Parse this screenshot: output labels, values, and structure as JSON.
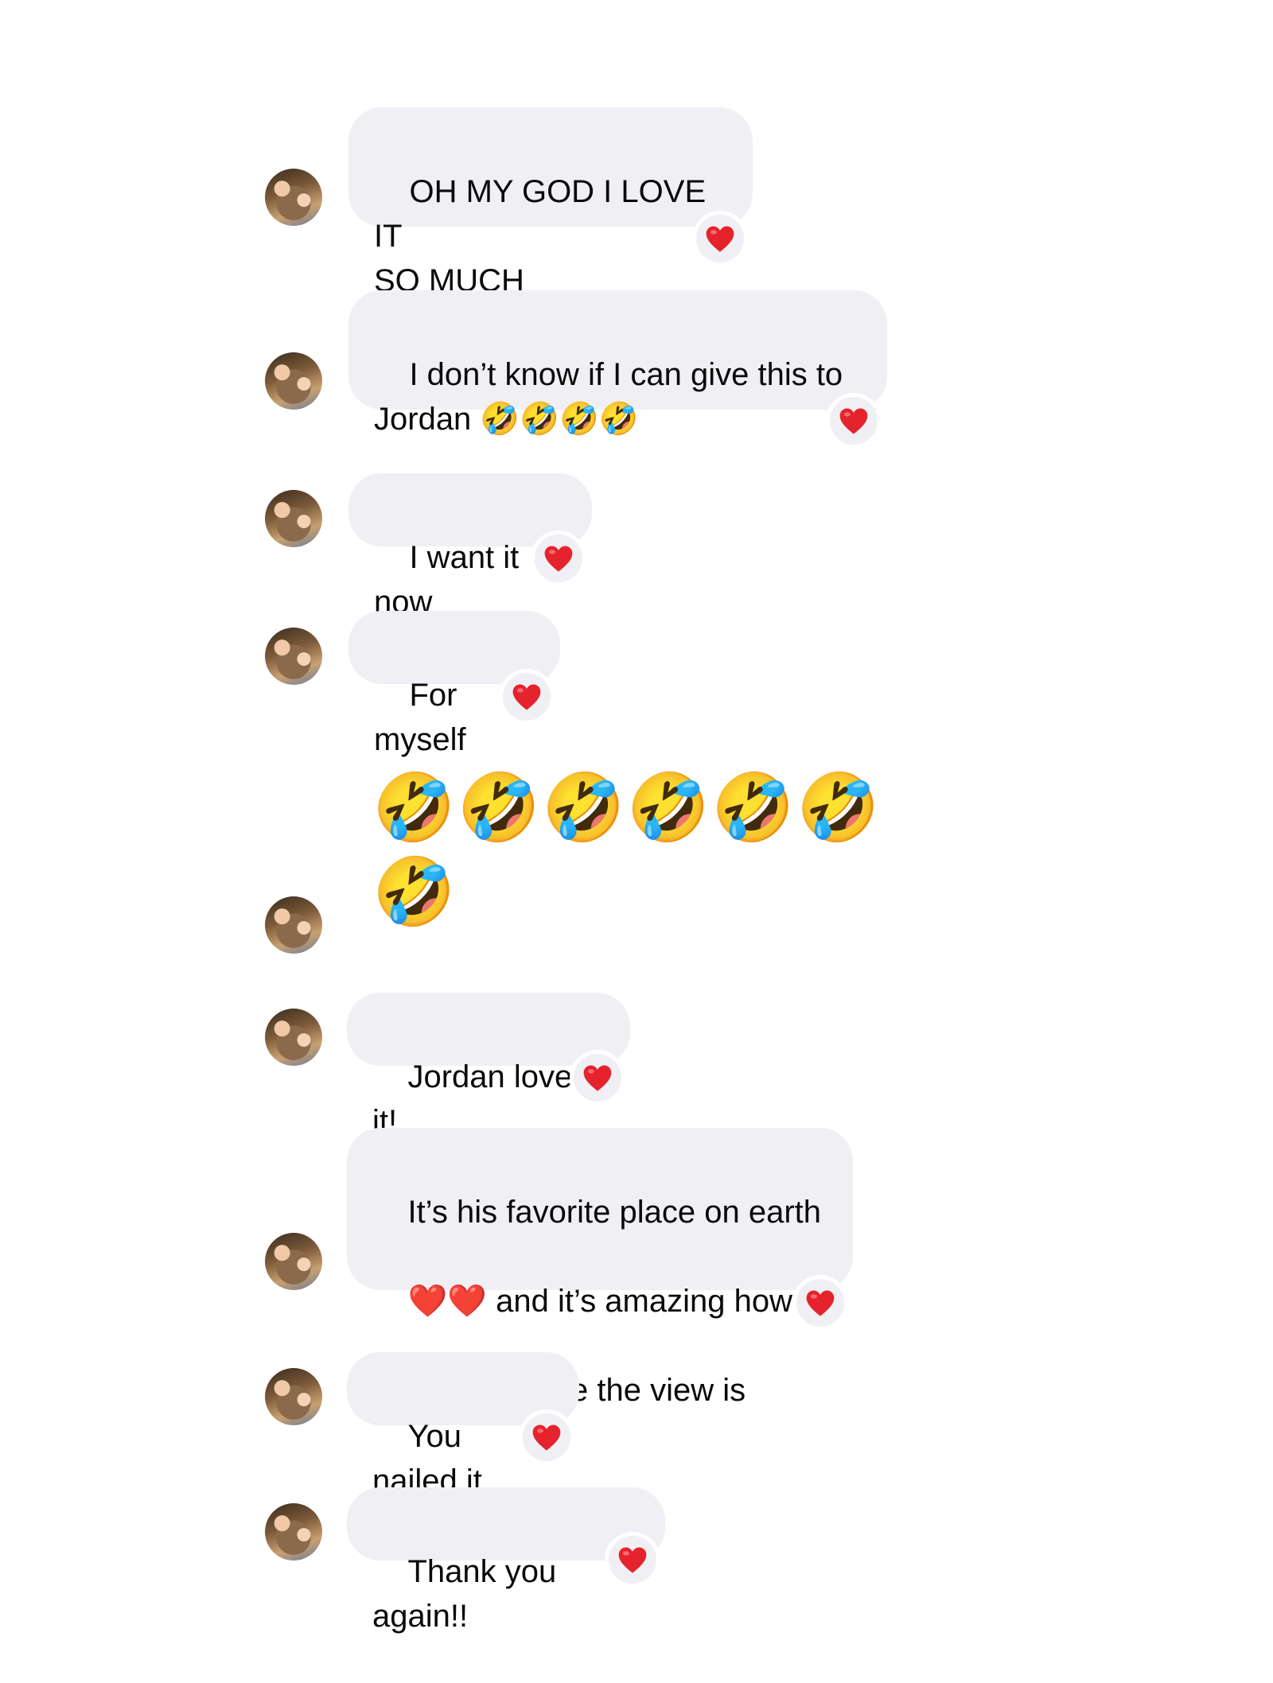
{
  "colors": {
    "bubble": "#f0f0f4",
    "text": "#0a0a0a",
    "heart": "#e5232c",
    "background": "#ffffff"
  },
  "reaction_icon": "heart-icon",
  "messages": [
    {
      "text": "OH MY GOD I LOVE IT\nSO MUCH",
      "reaction": "❤️"
    },
    {
      "text": "I don’t know if I can give this to\nJordan 🤣🤣🤣🤣",
      "reaction": "❤️"
    },
    {
      "text": "I want it now",
      "reaction": "❤️"
    },
    {
      "text": "For myself",
      "reaction": "❤️"
    },
    {
      "text": "🤣🤣🤣🤣🤣🤣🤣",
      "reaction": ""
    },
    {
      "text": "Jordan loved it!",
      "reaction": "❤️"
    },
    {
      "text_line1": "It’s his favorite place on earth",
      "text_line2_after": " and it’s amazing how",
      "text_line3": "recognizable the view is",
      "inline_emoji": "❤️❤️",
      "reaction": "❤️"
    },
    {
      "text": "You nailed it",
      "reaction": "❤️"
    },
    {
      "text": "Thank you again!!",
      "reaction": "❤️"
    }
  ]
}
